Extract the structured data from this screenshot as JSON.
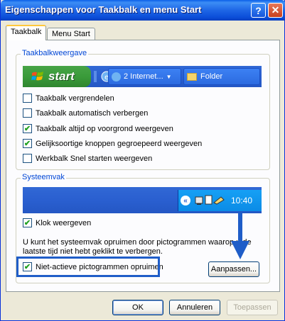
{
  "window": {
    "title": "Eigenschappen voor Taakbalk en menu Start"
  },
  "titlebar": {
    "help_label": "?",
    "close_label": "✕"
  },
  "tabs": [
    {
      "label": "Taakbalk",
      "active": true
    },
    {
      "label": "Menu Start",
      "active": false
    }
  ],
  "taakbalk_group": {
    "legend": "Taakbalkweergave",
    "preview": {
      "start_label": "start",
      "task_buttons": [
        "2 Internet...",
        "Folder"
      ]
    },
    "options": [
      {
        "label": "Taakbalk vergrendelen",
        "checked": false
      },
      {
        "label": "Taakbalk automatisch verbergen",
        "checked": false
      },
      {
        "label": "Taakbalk altijd op voorgrond weergeven",
        "checked": true
      },
      {
        "label": "Gelijksoortige knoppen gegroepeerd weergeven",
        "checked": true
      },
      {
        "label": "Werkbalk Snel starten weergeven",
        "checked": false
      }
    ]
  },
  "systeemvak_group": {
    "legend": "Systeemvak",
    "clock_time": "10:40",
    "options": [
      {
        "label": "Klok weergeven",
        "checked": true
      }
    ],
    "info_text": "U kunt het systeemvak opruimen door pictogrammen waarop u de laatste tijd niet hebt geklikt te verbergen.",
    "hide_inactive": {
      "label": "Niet-actieve pictogrammen opruimen",
      "checked": true
    },
    "customize_label": "Aanpassen..."
  },
  "buttons": {
    "ok": "OK",
    "cancel": "Annuleren",
    "apply": "Toepassen"
  },
  "colors": {
    "accent": "#1F5DC8",
    "titlebar": "#0A5FE8",
    "check": "#21A121"
  }
}
